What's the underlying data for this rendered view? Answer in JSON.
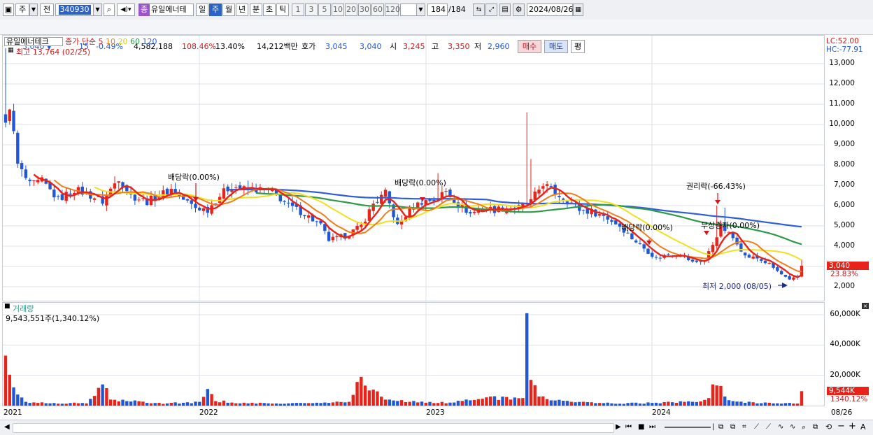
{
  "toolbar": {
    "market_tab": "주",
    "prev_label": "전",
    "code": "340930",
    "stock_badge": "종",
    "stock_name": "유일에너테",
    "period_tabs": [
      "일",
      "주",
      "월",
      "년",
      "분",
      "초",
      "틱"
    ],
    "active_period": "주",
    "interval_buttons": [
      "1",
      "3",
      "5",
      "10",
      "20",
      "30",
      "60",
      "120"
    ],
    "count_value": "184",
    "count_total": "/184",
    "date": "2024/08/26"
  },
  "infobar": {
    "price": "3,040",
    "change_arrow": "▼",
    "change": "15",
    "change_pct": "-0.49%",
    "volume": "4,582,188",
    "volume_pct": "108.46%",
    "turnover": "13.40%",
    "amount": "14,212백만",
    "hoga_label": "호가",
    "ask": "3,045",
    "bid": "3,040",
    "open_label": "시",
    "open": "3,245",
    "high_label": "고",
    "high": "3,350",
    "low_label": "저",
    "low": "2,960",
    "buy_label": "매수",
    "sell_label": "매도",
    "eval_label": "평"
  },
  "colors": {
    "up": "#e8231a",
    "down": "#1f57d6",
    "ma5": "#e8231a",
    "ma10": "#f07d1b",
    "ma20": "#f0e01e",
    "ma60": "#2e9a48",
    "ma120": "#2f5fd8"
  },
  "chart_data": [
    {
      "type": "candlestick",
      "title": "유일에너테크",
      "legend": {
        "label": "종가 단순",
        "periods": [
          "5",
          "10",
          "20",
          "60",
          "120"
        ]
      },
      "high_annotation": "최고 13,764 (02/25)",
      "low_annotation": "최저 2,000 (08/05)",
      "top_right": [
        "LC:52.00",
        "HC:-77.91"
      ],
      "current_price_label": "3,040",
      "current_change_label": "23.83%",
      "y_ticks": [
        "13,000",
        "12,000",
        "11,000",
        "10,000",
        "9,000",
        "8,000",
        "7,000",
        "6,000",
        "5,000",
        "4,000",
        "3,000",
        "2,000"
      ],
      "y_tick_values": [
        13000,
        12000,
        11000,
        10000,
        9000,
        8000,
        7000,
        6000,
        5000,
        4000,
        3000,
        2000
      ],
      "ylim": [
        1700,
        14000
      ],
      "x_ticks": [
        "2021",
        "2022",
        "2023",
        "2024"
      ],
      "x_end_label": "08/26",
      "events": [
        {
          "label": "배당락(0.00%)",
          "week": 53
        },
        {
          "label": "배당락(0.00%)",
          "week": 109
        },
        {
          "label": "배당락(0.00%)",
          "week": 165
        },
        {
          "label": "권리락(-66.43%)",
          "week": 176
        },
        {
          "label": "무상증자(0.00%)",
          "week": 177
        }
      ],
      "close_anchors": [
        [
          0,
          9900
        ],
        [
          1,
          11000
        ],
        [
          3,
          8000
        ],
        [
          6,
          7000
        ],
        [
          9,
          7200
        ],
        [
          13,
          6300
        ],
        [
          17,
          6800
        ],
        [
          20,
          6600
        ],
        [
          24,
          6200
        ],
        [
          28,
          7400
        ],
        [
          31,
          6500
        ],
        [
          35,
          6200
        ],
        [
          38,
          6500
        ],
        [
          41,
          6800
        ],
        [
          44,
          6300
        ],
        [
          47,
          5900
        ],
        [
          50,
          5800
        ],
        [
          53,
          6500
        ],
        [
          56,
          7000
        ],
        [
          59,
          6800
        ],
        [
          62,
          6800
        ],
        [
          66,
          6700
        ],
        [
          70,
          6000
        ],
        [
          74,
          5600
        ],
        [
          78,
          5000
        ],
        [
          80,
          4300
        ],
        [
          84,
          4500
        ],
        [
          88,
          5000
        ],
        [
          91,
          6100
        ],
        [
          94,
          6600
        ],
        [
          97,
          5000
        ],
        [
          100,
          5800
        ],
        [
          103,
          6200
        ],
        [
          106,
          6300
        ],
        [
          109,
          6700
        ],
        [
          112,
          6100
        ],
        [
          115,
          5600
        ],
        [
          118,
          5900
        ],
        [
          121,
          5800
        ],
        [
          124,
          5900
        ],
        [
          127,
          5900
        ],
        [
          130,
          6200
        ],
        [
          133,
          7100
        ],
        [
          136,
          6600
        ],
        [
          139,
          6300
        ],
        [
          142,
          5800
        ],
        [
          145,
          5700
        ],
        [
          148,
          5500
        ],
        [
          152,
          5000
        ],
        [
          155,
          4400
        ],
        [
          158,
          3900
        ],
        [
          161,
          3400
        ],
        [
          164,
          3600
        ],
        [
          167,
          3600
        ],
        [
          170,
          3200
        ],
        [
          173,
          3300
        ],
        [
          175,
          4100
        ],
        [
          177,
          5000
        ],
        [
          179,
          4600
        ],
        [
          181,
          4200
        ],
        [
          183,
          3500
        ],
        [
          186,
          3400
        ],
        [
          189,
          3100
        ],
        [
          192,
          2600
        ],
        [
          194,
          2300
        ],
        [
          195,
          2400
        ],
        [
          196,
          2450
        ],
        [
          197,
          3040
        ]
      ],
      "spikes": [
        {
          "week": 0,
          "high": 13764
        },
        {
          "week": 107,
          "high": 7600
        },
        {
          "week": 129,
          "high": 10600
        },
        {
          "week": 130,
          "high": 8300
        },
        {
          "week": 176,
          "high": 6000
        },
        {
          "week": 178,
          "high": 5900
        },
        {
          "week": 197,
          "high": 3350
        }
      ]
    },
    {
      "type": "bar",
      "title": "거래량",
      "summary": "9,543,551주(1,340.12%)",
      "y_ticks": [
        "60,000K",
        "40,000K",
        "20,000K"
      ],
      "y_tick_values": [
        60000,
        40000,
        20000
      ],
      "ylim": [
        0,
        63000
      ],
      "current_volume_label": "9,544K",
      "current_volume_pct": "1340.12%",
      "unit": "K",
      "volume_anchors": [
        [
          0,
          33000
        ],
        [
          2,
          12000
        ],
        [
          5,
          2500
        ],
        [
          10,
          1600
        ],
        [
          20,
          1500
        ],
        [
          24,
          14000
        ],
        [
          26,
          4000
        ],
        [
          30,
          3000
        ],
        [
          40,
          1500
        ],
        [
          48,
          2500
        ],
        [
          50,
          11000
        ],
        [
          52,
          3000
        ],
        [
          60,
          1500
        ],
        [
          70,
          1500
        ],
        [
          80,
          1800
        ],
        [
          85,
          2500
        ],
        [
          88,
          19000
        ],
        [
          90,
          10000
        ],
        [
          95,
          4000
        ],
        [
          100,
          2500
        ],
        [
          110,
          2000
        ],
        [
          115,
          3500
        ],
        [
          120,
          6000
        ],
        [
          125,
          4000
        ],
        [
          128,
          5000
        ],
        [
          129,
          61000
        ],
        [
          130,
          17000
        ],
        [
          132,
          6000
        ],
        [
          140,
          2500
        ],
        [
          150,
          1500
        ],
        [
          160,
          1800
        ],
        [
          170,
          2500
        ],
        [
          174,
          5000
        ],
        [
          175,
          14000
        ],
        [
          177,
          13000
        ],
        [
          178,
          6000
        ],
        [
          180,
          3000
        ],
        [
          190,
          1500
        ],
        [
          196,
          1400
        ],
        [
          197,
          9544
        ]
      ]
    }
  ]
}
